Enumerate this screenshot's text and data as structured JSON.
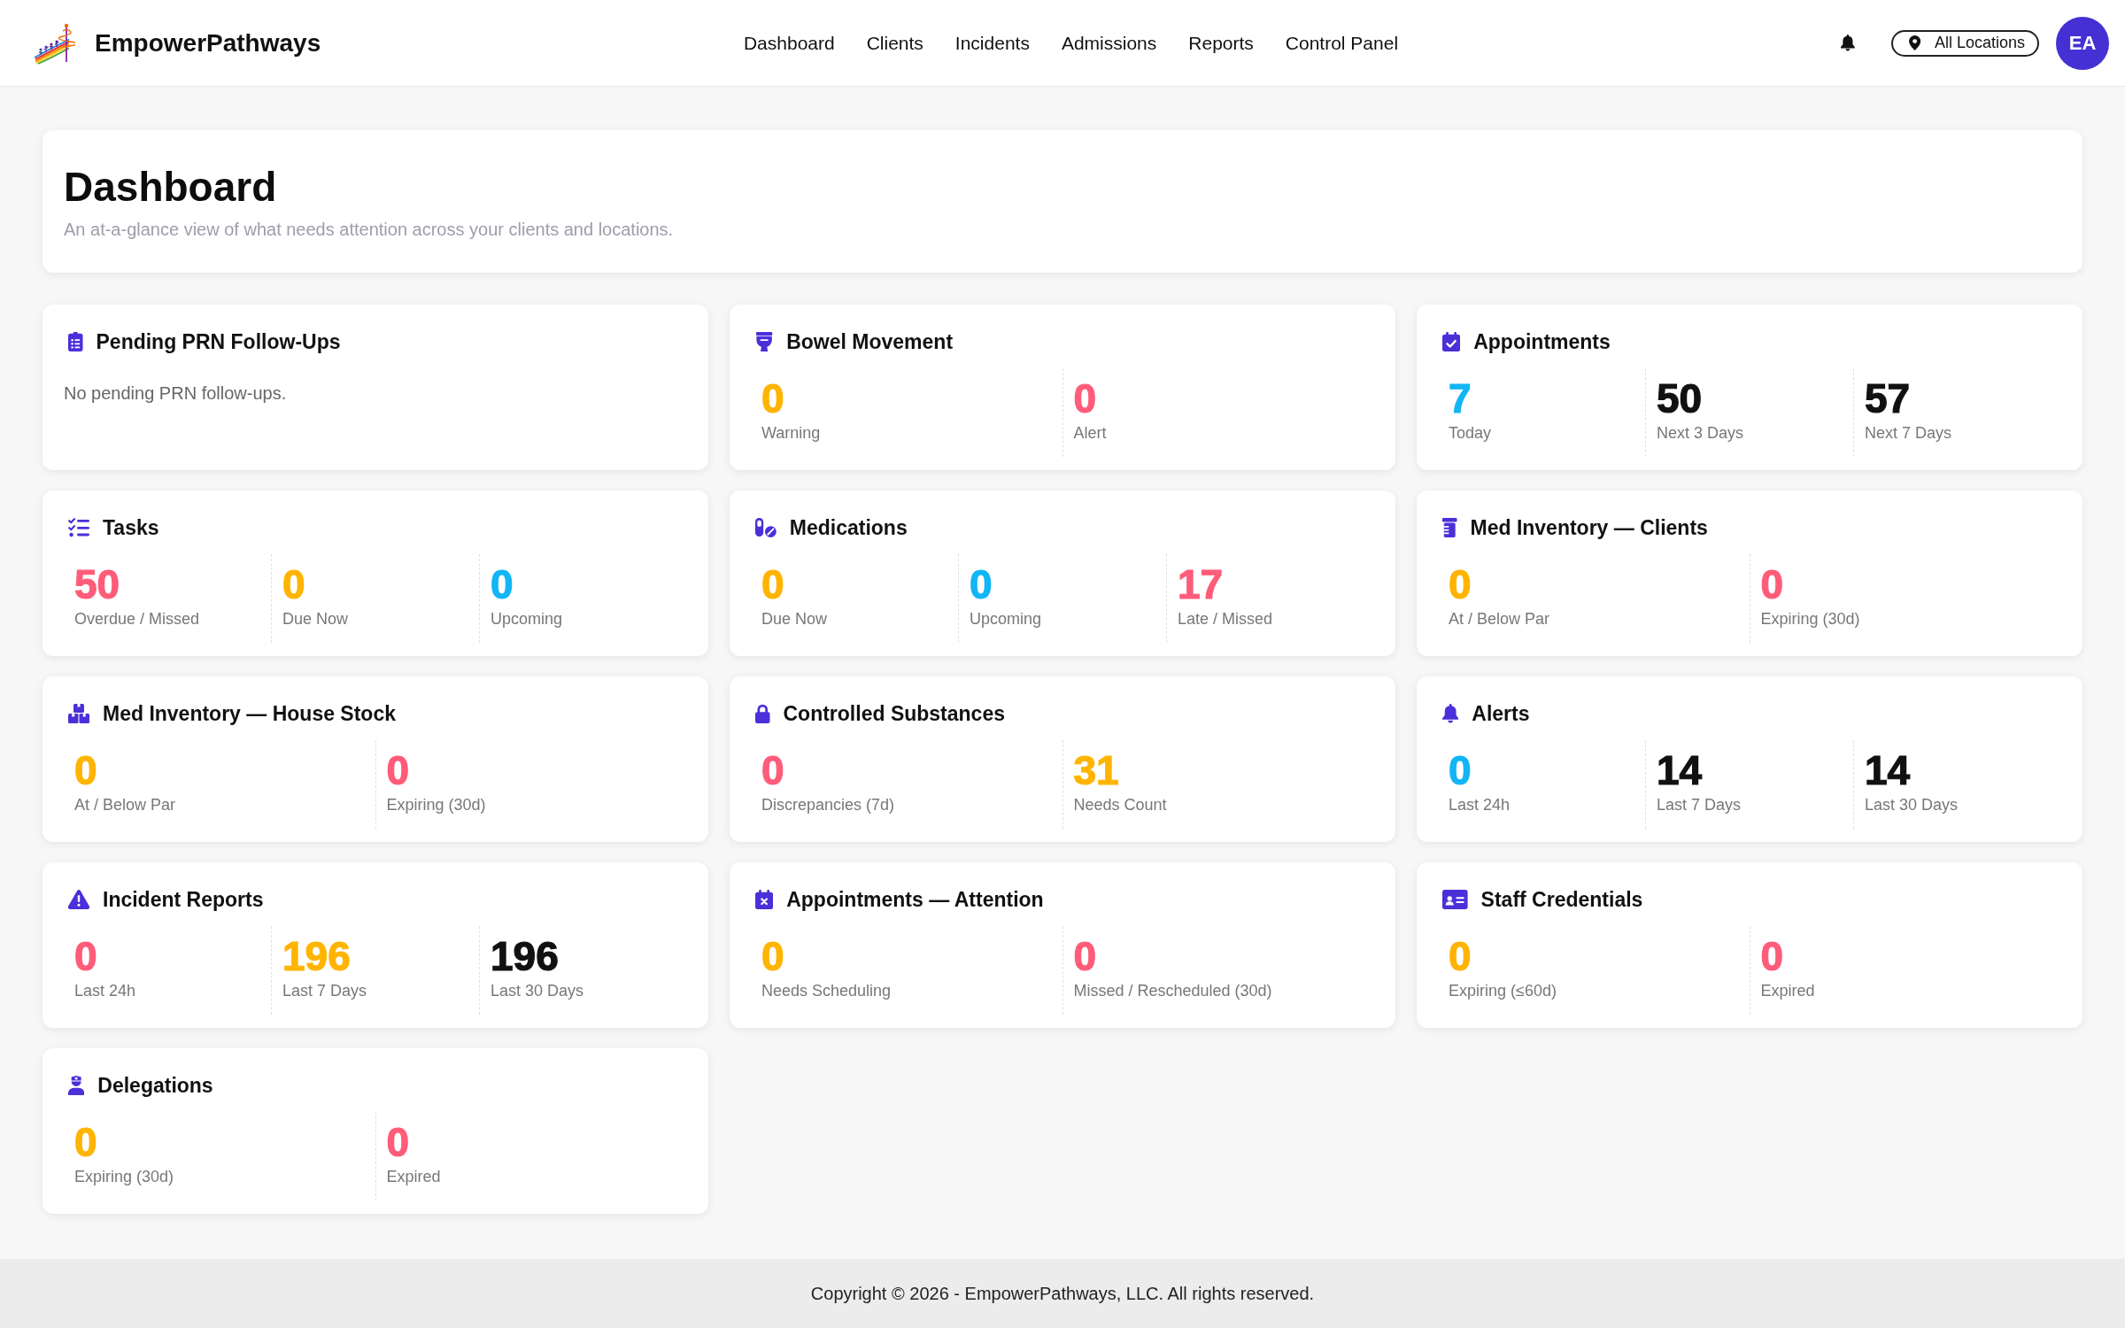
{
  "header": {
    "brand": "EmpowerPathways",
    "nav": [
      "Dashboard",
      "Clients",
      "Incidents",
      "Admissions",
      "Reports",
      "Control Panel"
    ],
    "location": "All Locations",
    "avatar": "EA"
  },
  "page": {
    "title": "Dashboard",
    "subtitle": "An at-a-glance view of what needs attention across your clients and locations."
  },
  "cards": [
    {
      "title": "Pending PRN Follow-Ups",
      "kind": "message",
      "message": "No pending PRN follow-ups."
    },
    {
      "title": "Bowel Movement",
      "kind": "stats",
      "stats": [
        {
          "value": "0",
          "label": "Warning",
          "color": "#ffb400"
        },
        {
          "value": "0",
          "label": "Alert",
          "color": "#ff5c7a"
        }
      ]
    },
    {
      "title": "Appointments",
      "kind": "stats",
      "stats": [
        {
          "value": "7",
          "label": "Today",
          "color": "#12b5f5"
        },
        {
          "value": "50",
          "label": "Next 3 Days",
          "color": "#111111"
        },
        {
          "value": "57",
          "label": "Next 7 Days",
          "color": "#111111"
        }
      ]
    },
    {
      "title": "Tasks",
      "kind": "stats",
      "stats": [
        {
          "value": "50",
          "label": "Overdue / Missed",
          "color": "#ff5c7a"
        },
        {
          "value": "0",
          "label": "Due Now",
          "color": "#ffb400"
        },
        {
          "value": "0",
          "label": "Upcoming",
          "color": "#12b5f5"
        }
      ]
    },
    {
      "title": "Medications",
      "kind": "stats",
      "stats": [
        {
          "value": "0",
          "label": "Due Now",
          "color": "#ffb400"
        },
        {
          "value": "0",
          "label": "Upcoming",
          "color": "#12b5f5"
        },
        {
          "value": "17",
          "label": "Late / Missed",
          "color": "#ff5c7a"
        }
      ]
    },
    {
      "title": "Med Inventory — Clients",
      "kind": "stats",
      "stats": [
        {
          "value": "0",
          "label": "At / Below Par",
          "color": "#ffb400"
        },
        {
          "value": "0",
          "label": "Expiring (30d)",
          "color": "#ff5c7a"
        }
      ]
    },
    {
      "title": "Med Inventory — House Stock",
      "kind": "stats",
      "stats": [
        {
          "value": "0",
          "label": "At / Below Par",
          "color": "#ffb400"
        },
        {
          "value": "0",
          "label": "Expiring (30d)",
          "color": "#ff5c7a"
        }
      ]
    },
    {
      "title": "Controlled Substances",
      "kind": "stats",
      "stats": [
        {
          "value": "0",
          "label": "Discrepancies (7d)",
          "color": "#ff5c7a"
        },
        {
          "value": "31",
          "label": "Needs Count",
          "color": "#ffb400"
        }
      ]
    },
    {
      "title": "Alerts",
      "kind": "stats",
      "stats": [
        {
          "value": "0",
          "label": "Last 24h",
          "color": "#12b5f5"
        },
        {
          "value": "14",
          "label": "Last 7 Days",
          "color": "#111111"
        },
        {
          "value": "14",
          "label": "Last 30 Days",
          "color": "#111111"
        }
      ]
    },
    {
      "title": "Incident Reports",
      "kind": "stats",
      "stats": [
        {
          "value": "0",
          "label": "Last 24h",
          "color": "#ff5c7a"
        },
        {
          "value": "196",
          "label": "Last 7 Days",
          "color": "#ffb400"
        },
        {
          "value": "196",
          "label": "Last 30 Days",
          "color": "#111111"
        }
      ]
    },
    {
      "title": "Appointments — Attention",
      "kind": "stats",
      "stats": [
        {
          "value": "0",
          "label": "Needs Scheduling",
          "color": "#ffb400"
        },
        {
          "value": "0",
          "label": "Missed / Rescheduled (30d)",
          "color": "#ff5c7a"
        }
      ]
    },
    {
      "title": "Staff Credentials",
      "kind": "stats",
      "stats": [
        {
          "value": "0",
          "label": "Expiring (≤60d)",
          "color": "#ffb400"
        },
        {
          "value": "0",
          "label": "Expired",
          "color": "#ff5c7a"
        }
      ]
    },
    {
      "title": "Delegations",
      "kind": "stats",
      "stats": [
        {
          "value": "0",
          "label": "Expiring (30d)",
          "color": "#ffb400"
        },
        {
          "value": "0",
          "label": "Expired",
          "color": "#ff5c7a"
        }
      ]
    }
  ],
  "footer": "Copyright © 2026 - EmpowerPathways, LLC. All rights reserved."
}
